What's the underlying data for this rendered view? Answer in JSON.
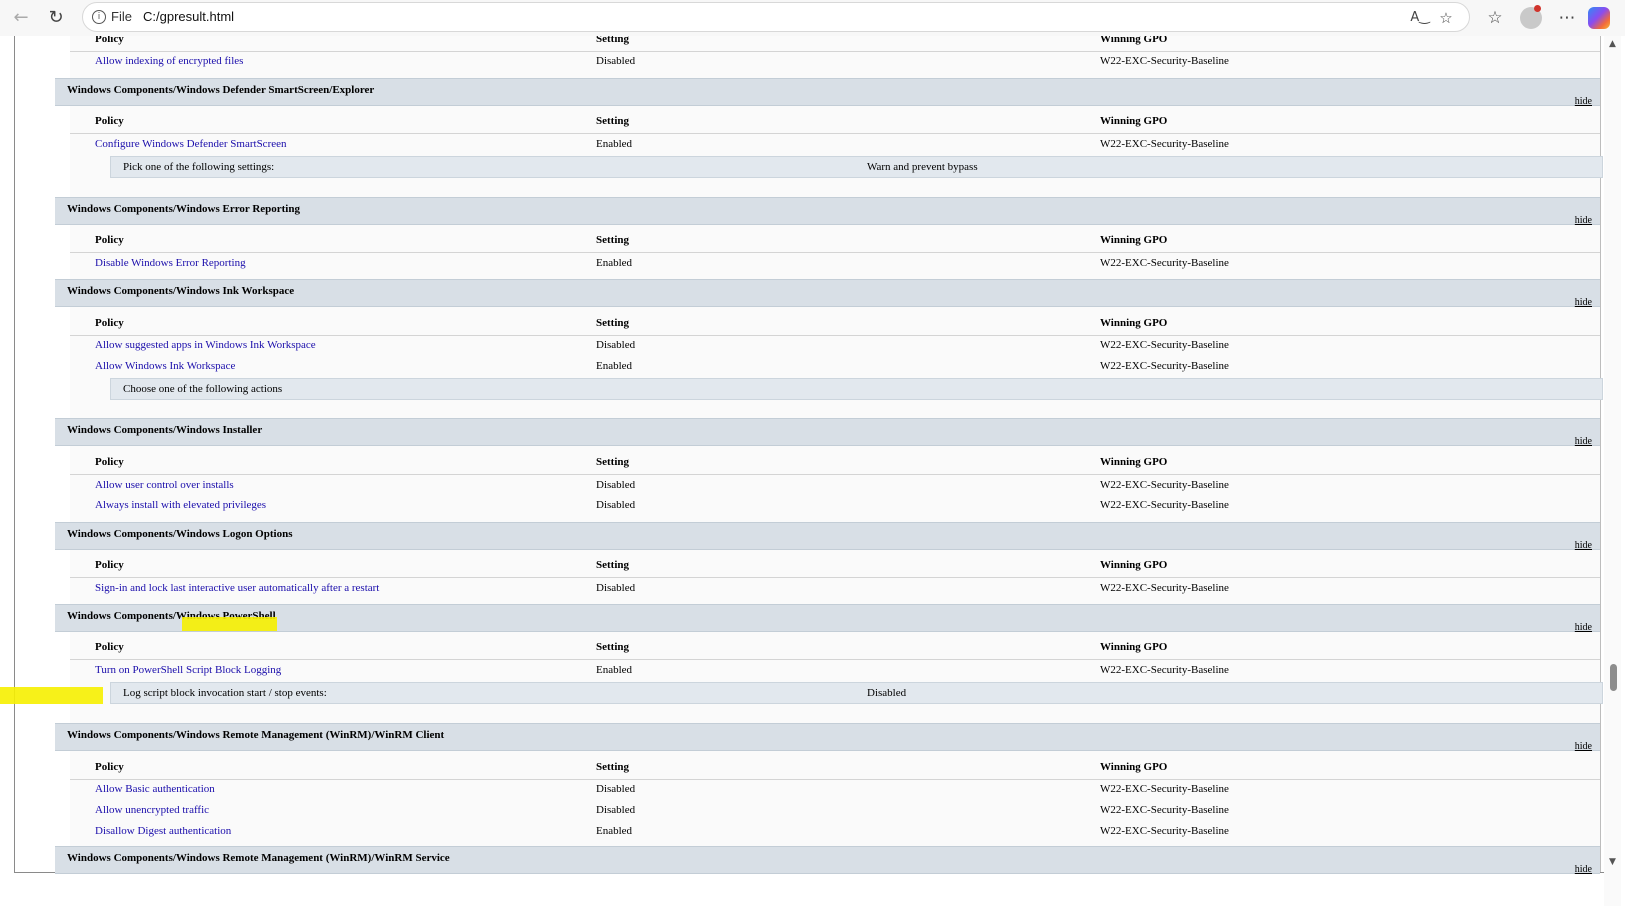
{
  "browser": {
    "scheme_label": "File",
    "url": "C:/gpresult.html",
    "icons": [
      "back-arrow-icon",
      "refresh-icon",
      "info-icon",
      "read-aloud-icon",
      "favorite-star-icon",
      "favorites-list-icon",
      "profile-avatar",
      "more-options-icon",
      "copilot-icon"
    ]
  },
  "headers": {
    "policy": "Policy",
    "setting": "Setting",
    "winning_gpo": "Winning GPO"
  },
  "hide_label": "hide",
  "top_partial": {
    "rows": [
      {
        "policy": "Allow indexing of encrypted files",
        "setting": "Disabled",
        "gpo": "W22-EXC-Security-Baseline"
      }
    ]
  },
  "sections": [
    {
      "title": "Windows Components/Windows Defender SmartScreen/Explorer",
      "rows": [
        {
          "policy": "Configure Windows Defender SmartScreen",
          "setting": "Enabled",
          "gpo": "W22-EXC-Security-Baseline"
        }
      ],
      "detail": {
        "label": "Pick one of the following settings:",
        "value": "Warn and prevent bypass"
      }
    },
    {
      "title": "Windows Components/Windows Error Reporting",
      "rows": [
        {
          "policy": "Disable Windows Error Reporting",
          "setting": "Enabled",
          "gpo": "W22-EXC-Security-Baseline"
        }
      ]
    },
    {
      "title": "Windows Components/Windows Ink Workspace",
      "rows": [
        {
          "policy": "Allow suggested apps in Windows Ink Workspace",
          "setting": "Disabled",
          "gpo": "W22-EXC-Security-Baseline"
        },
        {
          "policy": "Allow Windows Ink Workspace",
          "setting": "Enabled",
          "gpo": "W22-EXC-Security-Baseline"
        }
      ],
      "detail": {
        "label": "Choose one of the following actions",
        "value": ""
      }
    },
    {
      "title": "Windows Components/Windows Installer",
      "rows": [
        {
          "policy": "Allow user control over installs",
          "setting": "Disabled",
          "gpo": "W22-EXC-Security-Baseline"
        },
        {
          "policy": "Always install with elevated privileges",
          "setting": "Disabled",
          "gpo": "W22-EXC-Security-Baseline"
        }
      ]
    },
    {
      "title": "Windows Components/Windows Logon Options",
      "rows": [
        {
          "policy": "Sign-in and lock last interactive user automatically after a restart",
          "setting": "Disabled",
          "gpo": "W22-EXC-Security-Baseline"
        }
      ]
    },
    {
      "title": "Windows Components/Windows PowerShell",
      "rows": [
        {
          "policy": "Turn on PowerShell Script Block Logging",
          "setting": "Enabled",
          "gpo": "W22-EXC-Security-Baseline"
        }
      ],
      "detail": {
        "label": "Log script block invocation start / stop events:",
        "value": "Disabled"
      }
    },
    {
      "title": "Windows Components/Windows Remote Management (WinRM)/WinRM Client",
      "rows": [
        {
          "policy": "Allow Basic authentication",
          "setting": "Disabled",
          "gpo": "W22-EXC-Security-Baseline"
        },
        {
          "policy": "Allow unencrypted traffic",
          "setting": "Disabled",
          "gpo": "W22-EXC-Security-Baseline"
        },
        {
          "policy": "Disallow Digest authentication",
          "setting": "Enabled",
          "gpo": "W22-EXC-Security-Baseline"
        }
      ]
    },
    {
      "title": "Windows Components/Windows Remote Management (WinRM)/WinRM Service",
      "rows": []
    }
  ],
  "highlight_color": "#f6f000"
}
